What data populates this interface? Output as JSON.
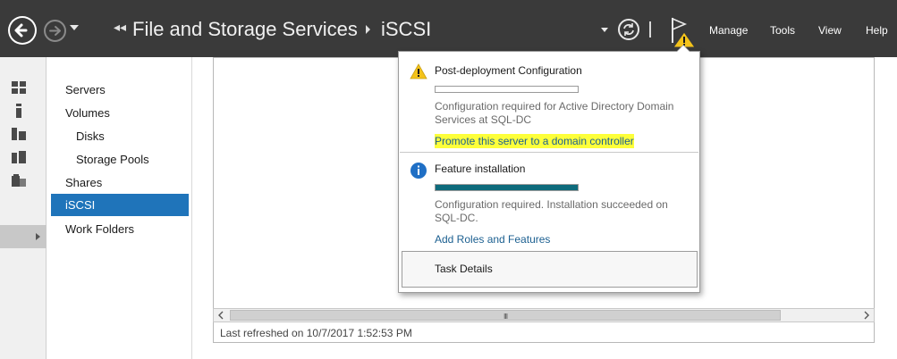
{
  "header": {
    "breadcrumb_arrows": "◂◂",
    "app_title": "File and Storage Services",
    "page_title": "iSCSI",
    "menu": [
      "Manage",
      "Tools",
      "View",
      "Help"
    ],
    "accent_color": "#3a3a3a"
  },
  "icons": {
    "back": "back-arrow-icon",
    "forward": "forward-arrow-icon",
    "refresh": "refresh-icon",
    "flag": "notification-flag-icon",
    "warning": "warning-icon",
    "info": "info-icon"
  },
  "sidebar": {
    "items": [
      {
        "label": "Servers",
        "sub": false,
        "selected": false
      },
      {
        "label": "Volumes",
        "sub": false,
        "selected": false
      },
      {
        "label": "Disks",
        "sub": true,
        "selected": false
      },
      {
        "label": "Storage Pools",
        "sub": true,
        "selected": false
      },
      {
        "label": "Shares",
        "sub": false,
        "selected": false
      },
      {
        "label": "iSCSI",
        "sub": false,
        "selected": true
      },
      {
        "label": "Work Folders",
        "sub": false,
        "selected": false
      }
    ]
  },
  "notifications": {
    "post_deployment": {
      "title": "Post-deployment Configuration",
      "progress": 0,
      "text": "Configuration required for Active Directory Domain Services at SQL-DC",
      "link": "Promote this server to a domain controller"
    },
    "feature_install": {
      "title": "Feature installation",
      "progress": 1,
      "text": "Configuration required. Installation succeeded on SQL-DC.",
      "link": "Add Roles and Features"
    },
    "task_details": "Task Details"
  },
  "status": {
    "last_refreshed": "Last refreshed on 10/7/2017 1:52:53 PM"
  },
  "scrollbar": {
    "grip": "III"
  }
}
